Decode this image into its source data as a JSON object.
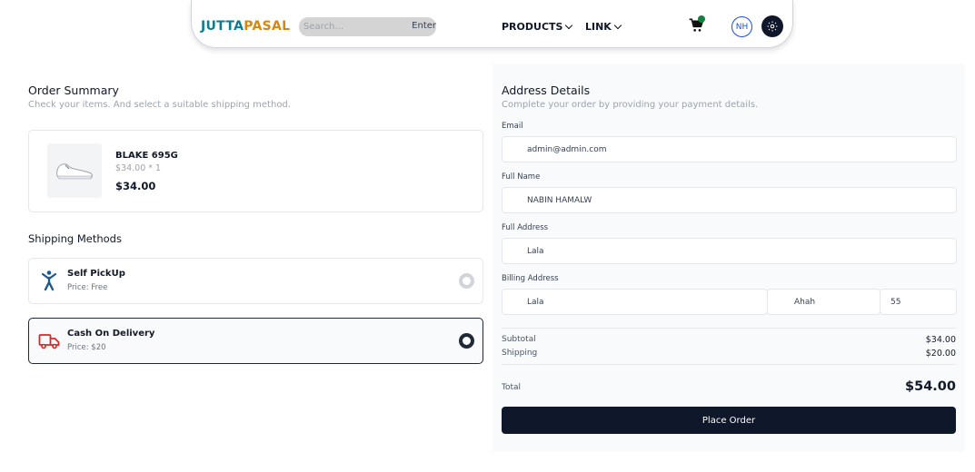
{
  "navbar": {
    "brand_part1": "JUTTA",
    "brand_part2": "PASAL",
    "search_placeholder": "Search...",
    "search_button": "Enter",
    "links": [
      {
        "label": "PRODUCTS"
      },
      {
        "label": "LINK"
      }
    ],
    "avatar_initials": "NH",
    "cart_icon": "cart-icon",
    "theme_icon": "sun-icon"
  },
  "order_summary": {
    "title": "Order Summary",
    "subtitle": "Check your items. And select a suitable shipping method.",
    "items": [
      {
        "name": "BLAKE 695G",
        "qty_price": "$34.00 * 1",
        "price": "$34.00",
        "image_icon": "shoe-icon"
      }
    ]
  },
  "shipping": {
    "title": "Shipping Methods",
    "methods": [
      {
        "name": "Self PickUp",
        "price": "Price: Free",
        "icon": "person-icon",
        "selected": false
      },
      {
        "name": "Cash On Delivery",
        "price": "Price: $20",
        "icon": "truck-icon",
        "selected": true
      }
    ]
  },
  "address": {
    "title": "Address Details",
    "subtitle": "Complete your order by providing your payment details.",
    "email_label": "Email",
    "email_value": "admin@admin.com",
    "fullname_label": "Full Name",
    "fullname_value": "NABIN HAMALW",
    "fulladdress_label": "Full Address",
    "fulladdress_value": "Lala",
    "billing_label": "Billing Address",
    "billing_street": "Lala",
    "billing_city": "Ahah",
    "billing_zip": "55"
  },
  "summary": {
    "subtotal_label": "Subtotal",
    "subtotal_value": "$34.00",
    "shipping_label": "Shipping",
    "shipping_value": "$20.00",
    "total_label": "Total",
    "total_value": "$54.00",
    "place_order": "Place Order"
  },
  "colors": {
    "brand_teal": "#0f7c8c",
    "brand_orange": "#d4880f",
    "dark": "#0f172a",
    "truck_red": "#dc2626",
    "person_blue": "#1e5a8a"
  }
}
